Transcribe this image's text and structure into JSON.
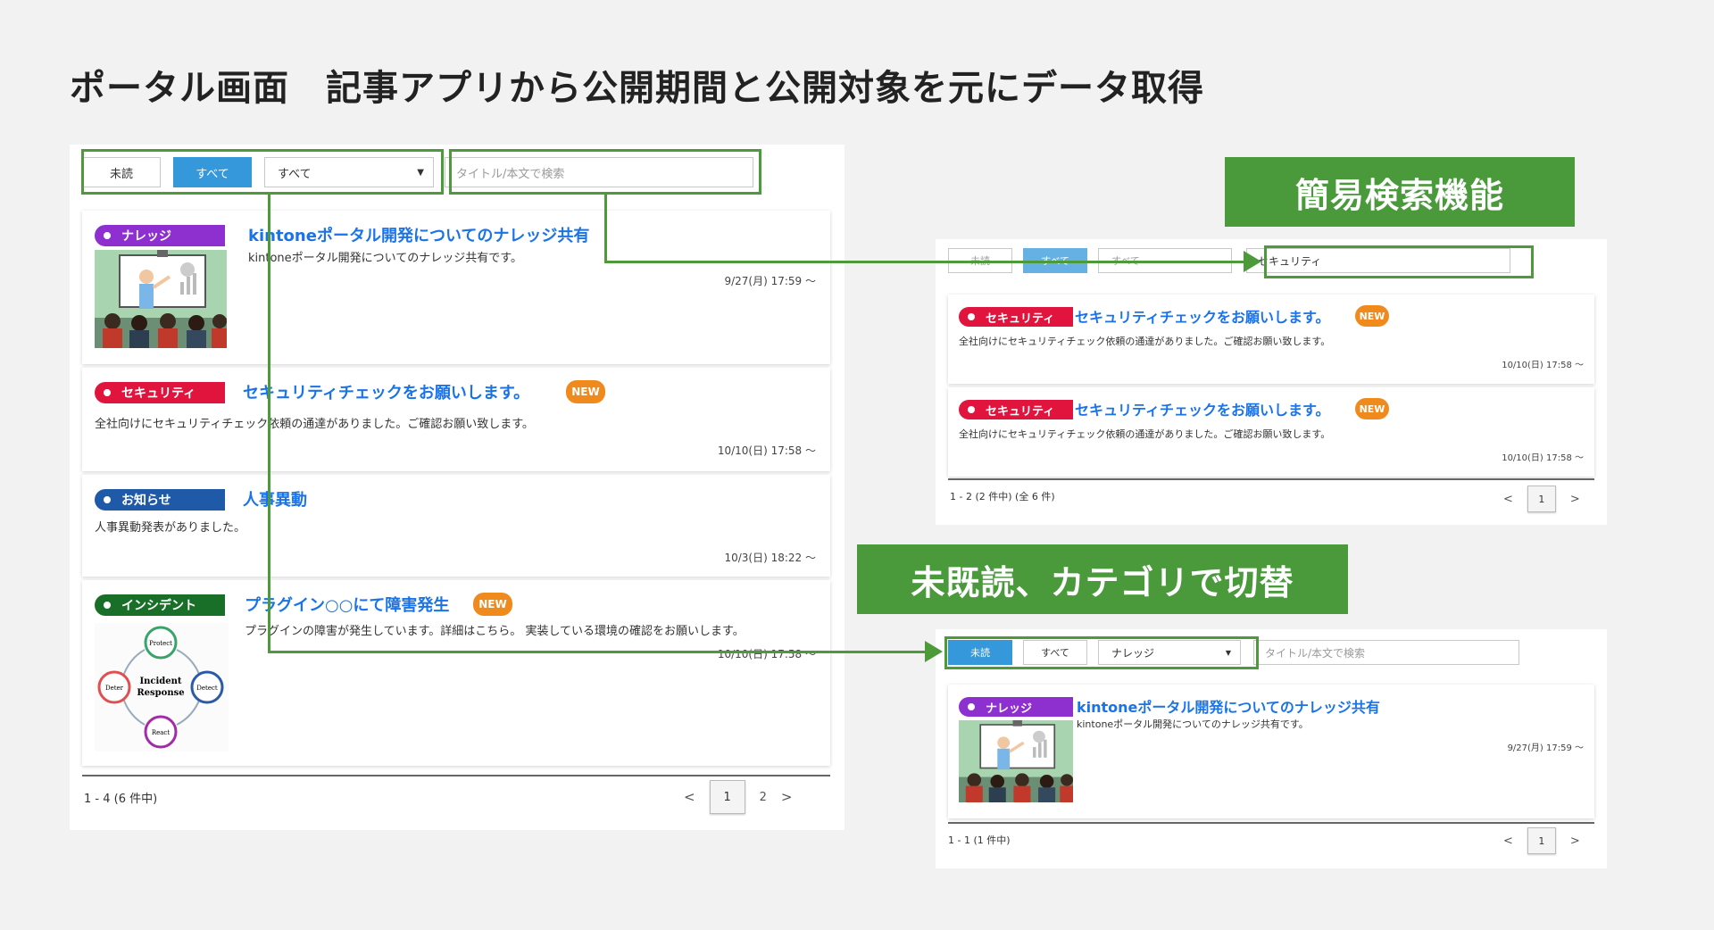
{
  "title": "ポータル画面　記事アプリから公開期間と公開対象を元にデータ取得",
  "labels": {
    "search_feature": "簡易検索機能",
    "filter_feature": "未既読、カテゴリで切替"
  },
  "colors": {
    "green": "#4a9a3c",
    "knowledge": "#8e2fcf",
    "security": "#e0143c",
    "notice": "#1e5aa8",
    "incident": "#1a6f28",
    "new": "#f08a1c",
    "link": "#1a73e8"
  },
  "main": {
    "btn_unread": "未読",
    "btn_all": "すべて",
    "select": "すべて",
    "search_placeholder": "タイトル/本文で検索",
    "articles": [
      {
        "category": "ナレッジ",
        "title": "kintoneポータル開発についてのナレッジ共有",
        "body": "kintoneポータル開発についてのナレッジ共有です。",
        "date": "9/27(月) 17:59 ～",
        "image": "presentation-illustration"
      },
      {
        "category": "セキュリティ",
        "title": "セキュリティチェックをお願いします。",
        "new": "NEW",
        "body": "全社向けにセキュリティチェック依頼の通達がありました。ご確認お願い致します。",
        "date": "10/10(日) 17:58 ～"
      },
      {
        "category": "お知らせ",
        "title": "人事異動",
        "body": "人事異動発表がありました。",
        "date": "10/3(日) 18:22 ～"
      },
      {
        "category": "インシデント",
        "title": "プラグイン○○にて障害発生",
        "new": "NEW",
        "body": "プラグインの障害が発生しています。詳細はこちら。 実装している環境の確認をお願いします。",
        "date": "10/10(日) 17:58 ～",
        "image": "incident-response-diagram",
        "diagram": {
          "center_line1": "Incident",
          "center_line2": "Response",
          "n": "Protect",
          "e": "Detect",
          "s": "React",
          "w": "Deter"
        }
      }
    ],
    "pagination": {
      "info": "1 - 4 (6 件中)",
      "prev": "<",
      "current": "1",
      "page2": "2",
      "next": ">"
    }
  },
  "search_panel": {
    "btn_unread": "未読",
    "btn_all": "すべて",
    "select": "すべて",
    "search_value": "セキュリティ",
    "articles": [
      {
        "category": "セキュリティ",
        "title": "セキュリティチェックをお願いします。",
        "new": "NEW",
        "body": "全社向けにセキュリティチェック依頼の通達がありました。ご確認お願い致します。",
        "date": "10/10(日) 17:58 ～"
      },
      {
        "category": "セキュリティ",
        "title": "セキュリティチェックをお願いします。",
        "new": "NEW",
        "body": "全社向けにセキュリティチェック依頼の通達がありました。ご確認お願い致します。",
        "date": "10/10(日) 17:58 ～"
      }
    ],
    "pagination": {
      "info": "1 - 2 (2 件中) (全 6 件)",
      "prev": "<",
      "current": "1",
      "next": ">"
    }
  },
  "filter_panel": {
    "btn_unread": "未読",
    "btn_all": "すべて",
    "select": "ナレッジ",
    "search_placeholder": "タイトル/本文で検索",
    "articles": [
      {
        "category": "ナレッジ",
        "title": "kintoneポータル開発についてのナレッジ共有",
        "body": "kintoneポータル開発についてのナレッジ共有です。",
        "date": "9/27(月) 17:59 ～",
        "image": "presentation-illustration"
      }
    ],
    "pagination": {
      "info": "1 - 1 (1 件中)",
      "prev": "<",
      "current": "1",
      "next": ">"
    }
  }
}
